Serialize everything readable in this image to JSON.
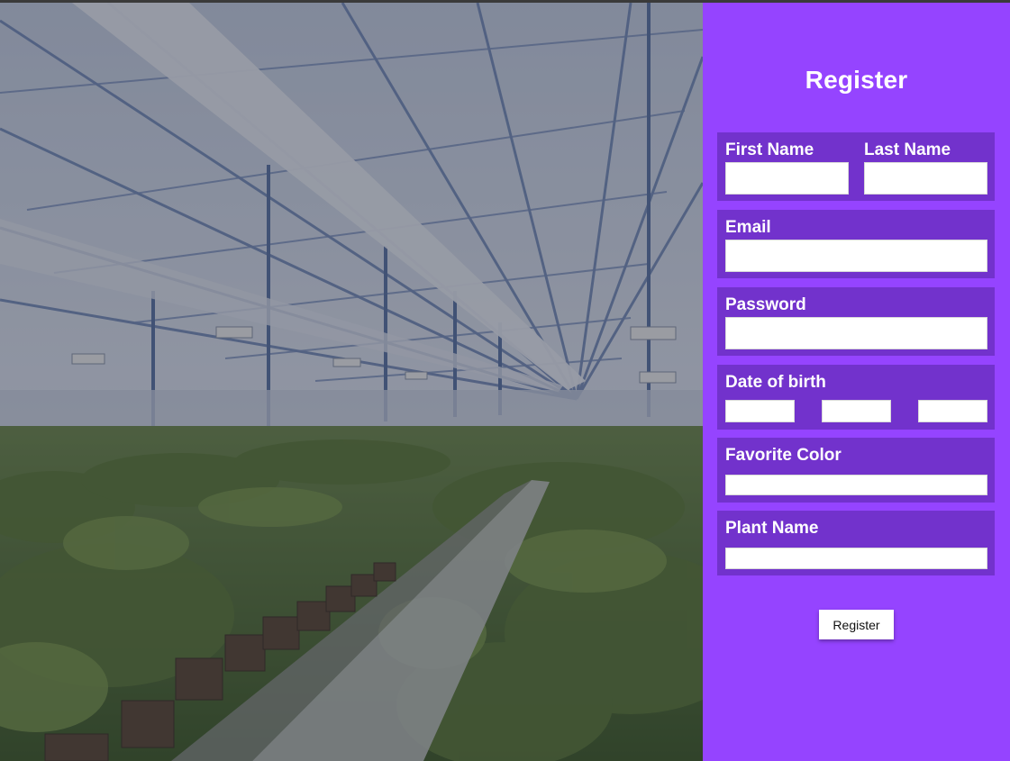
{
  "background_image": {
    "description_icon": "greenhouse-plants-photo"
  },
  "form": {
    "title": "Register",
    "first_name": {
      "label": "First Name",
      "value": ""
    },
    "last_name": {
      "label": "Last Name",
      "value": ""
    },
    "email": {
      "label": "Email",
      "value": ""
    },
    "password": {
      "label": "Password",
      "value": ""
    },
    "date_of_birth": {
      "label": "Date of birth",
      "month": "",
      "day": "",
      "year": ""
    },
    "favorite_color": {
      "label": "Favorite Color",
      "value": ""
    },
    "plant_name": {
      "label": "Plant Name",
      "value": ""
    },
    "submit_label": "Register"
  },
  "colors": {
    "panel_bg": "#9544ff",
    "group_bg": "#7232cc",
    "text": "#ffffff"
  }
}
